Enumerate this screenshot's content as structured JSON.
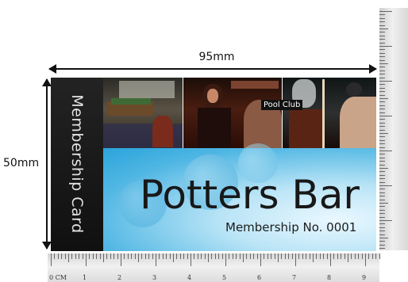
{
  "dimensions": {
    "width_label": "95mm",
    "height_label": "50mm"
  },
  "card": {
    "side_text": "Membership Card",
    "badge": "Pool Club",
    "title": "Potters Bar",
    "membership_number": "Membership No. 0001"
  },
  "rulers": {
    "bottom_labels": [
      "0 CM",
      "1",
      "2",
      "3",
      "4",
      "5",
      "6",
      "7",
      "8",
      "9"
    ]
  },
  "colors": {
    "side_panel": "#1a1a1a",
    "card_blue": "#2aa3da",
    "card_highlight": "#eaf8ff",
    "title_text": "#181818"
  }
}
